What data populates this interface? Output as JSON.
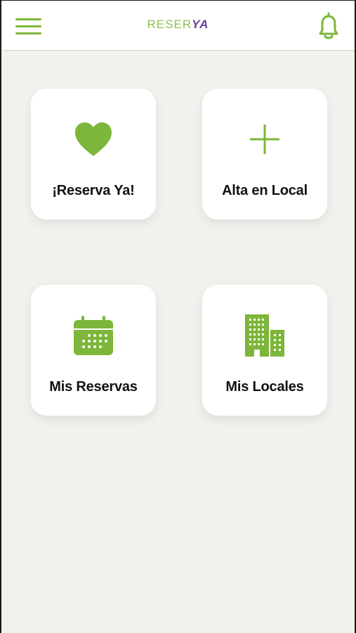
{
  "header": {
    "logo_part1": "RESER",
    "logo_part2": "YA",
    "menu_icon": "hamburger-icon",
    "notification_icon": "bell-icon"
  },
  "colors": {
    "accent_green": "#7db63a",
    "logo_purple": "#6a3d9a",
    "background": "#f1f1ee"
  },
  "tiles": [
    {
      "label": "¡Reserva Ya!",
      "icon": "heart-icon"
    },
    {
      "label": "Alta en Local",
      "icon": "plus-icon"
    },
    {
      "label": "Mis Reservas",
      "icon": "calendar-icon"
    },
    {
      "label": "Mis Locales",
      "icon": "building-icon"
    }
  ]
}
